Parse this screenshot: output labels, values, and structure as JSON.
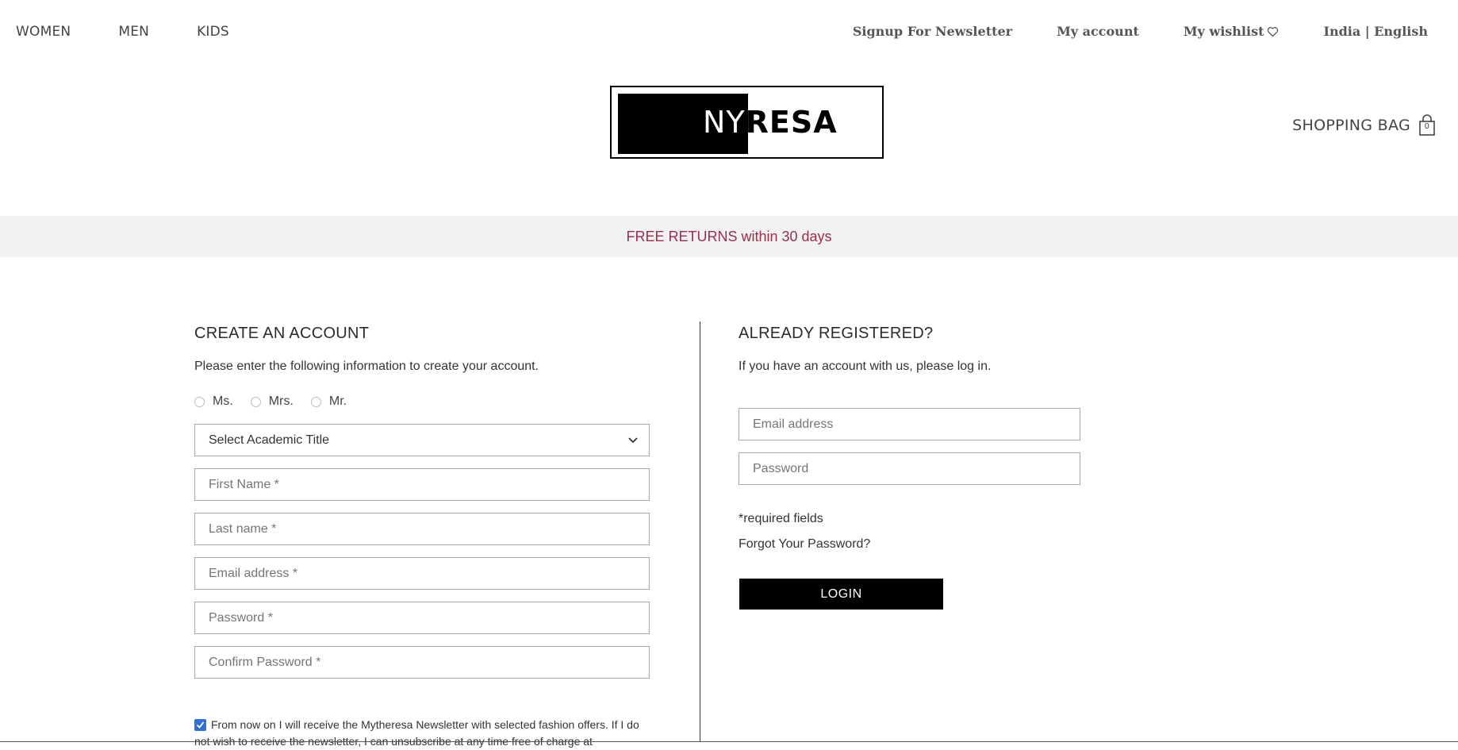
{
  "nav": {
    "left": [
      "WOMEN",
      "MEN",
      "KIDS"
    ],
    "right": {
      "newsletter": "Signup For Newsletter",
      "account": "My account",
      "wishlist": "My wishlist",
      "locale": "India | English"
    }
  },
  "logo": {
    "white_part": "NY",
    "black_part": "RESA"
  },
  "bag": {
    "label": "SHOPPING BAG",
    "count": "0"
  },
  "promo": "FREE RETURNS within 30 days",
  "create": {
    "heading": "CREATE AN ACCOUNT",
    "subtext": "Please enter the following information to create your account.",
    "salutations": [
      "Ms.",
      "Mrs.",
      "Mr."
    ],
    "academic_title": "Select Academic Title",
    "first_name_placeholder": "First Name *",
    "last_name_placeholder": "Last name *",
    "email_placeholder": "Email address *",
    "password_placeholder": "Password *",
    "confirm_password_placeholder": "Confirm Password *",
    "newsletter_text": "From now on I will receive the Mytheresa Newsletter with selected fashion offers. If I do not wish to receive the newsletter, I can unsubscribe at any time free of charge at",
    "newsletter_checked": true
  },
  "login": {
    "heading": "ALREADY REGISTERED?",
    "subtext": "If you have an account with us, please log in.",
    "email_placeholder": "Email address",
    "password_placeholder": "Password",
    "required_note": "*required fields",
    "forgot": "Forgot Your Password?",
    "button": "LOGIN"
  },
  "colors": {
    "promo_text": "#9a2e4b",
    "promo_bg": "#f2f2f2",
    "checkbox": "#2f6fd6"
  }
}
